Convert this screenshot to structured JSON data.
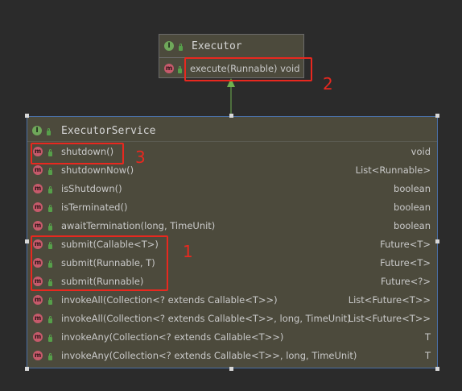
{
  "executor": {
    "name": "Executor",
    "methods": [
      {
        "signature": "execute(Runnable) void",
        "return": ""
      }
    ]
  },
  "executor_service": {
    "name": "ExecutorService",
    "methods": [
      {
        "signature": "shutdown()",
        "return": "void"
      },
      {
        "signature": "shutdownNow()",
        "return": "List<Runnable>"
      },
      {
        "signature": "isShutdown()",
        "return": "boolean"
      },
      {
        "signature": "isTerminated()",
        "return": "boolean"
      },
      {
        "signature": "awaitTermination(long, TimeUnit)",
        "return": "boolean"
      },
      {
        "signature": "submit(Callable<T>)",
        "return": "Future<T>"
      },
      {
        "signature": "submit(Runnable, T)",
        "return": "Future<T>"
      },
      {
        "signature": "submit(Runnable)",
        "return": "Future<?>"
      },
      {
        "signature": "invokeAll(Collection<? extends Callable<T>>)",
        "return": "List<Future<T>>"
      },
      {
        "signature": "invokeAll(Collection<? extends Callable<T>>, long, TimeUnit)",
        "return": "List<Future<T>>"
      },
      {
        "signature": "invokeAny(Collection<? extends Callable<T>>)",
        "return": "T"
      },
      {
        "signature": "invokeAny(Collection<? extends Callable<T>>, long, TimeUnit)",
        "return": "T"
      }
    ]
  },
  "icons": {
    "interface_letter": "I",
    "method_letter": "m",
    "interface_icon": "interface-icon",
    "method_icon": "method-icon",
    "public_icon": "lock-icon"
  },
  "annotations": [
    "1",
    "2",
    "3"
  ],
  "colors": {
    "background": "#2b2b2b",
    "box_fill": "#4c4a3c",
    "selection_border": "#4a6fa5",
    "highlight": "#e8281f",
    "arrow": "#6fb04f",
    "method_icon": "#c65a6b",
    "interface_icon": "#6fa85a"
  }
}
